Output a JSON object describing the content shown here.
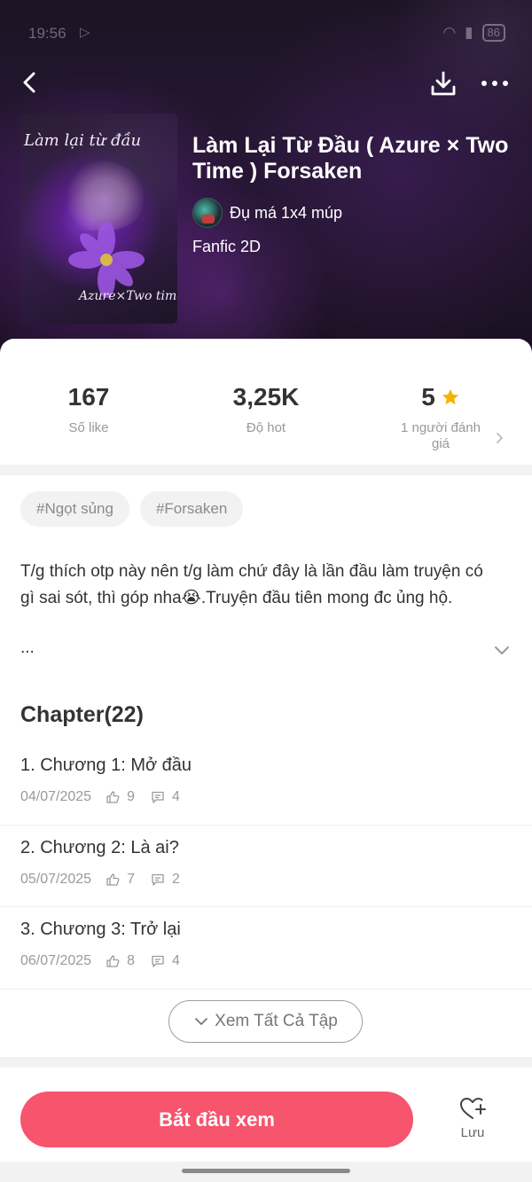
{
  "status_bar": {
    "time": "19:56",
    "battery": "86"
  },
  "header": {
    "cover_title_text": "Làm lại từ đầu",
    "cover_subtitle_text": "Azure×Two time",
    "title": "Làm Lại Từ Đầu ( Azure × Two Time ) Forsaken",
    "author": "Đụ má 1x4 múp",
    "genre": "Fanfic 2D"
  },
  "stats": {
    "likes": {
      "value": "167",
      "label": "Số like"
    },
    "hot": {
      "value": "3,25K",
      "label": "Độ hot"
    },
    "rating": {
      "value": "5",
      "label": "1 người đánh giá"
    }
  },
  "tags": [
    "#Ngọt sủng",
    "#Forsaken"
  ],
  "description": {
    "text": "T/g thích otp này nên t/g làm chứ đây là lần đầu làm truyện có gì sai sót, thì góp nha😭.Truyện đầu tiên mong đc ủng hộ.",
    "more": "..."
  },
  "chapters": {
    "heading": "Chapter(22)",
    "items": [
      {
        "title": "1. Chương 1: Mở đầu",
        "date": "04/07/2025",
        "likes": "9",
        "comments": "4"
      },
      {
        "title": "2. Chương 2: Là ai?",
        "date": "05/07/2025",
        "likes": "7",
        "comments": "2"
      },
      {
        "title": "3. Chương 3: Trở lại",
        "date": "06/07/2025",
        "likes": "8",
        "comments": "4"
      }
    ],
    "see_all_label": "Xem Tất Cả Tập"
  },
  "bottom_bar": {
    "start_label": "Bắt đầu xem",
    "save_label": "Lưu"
  },
  "colors": {
    "accent": "#f7546d",
    "star": "#f5b301"
  },
  "icons": [
    "back-arrow-icon",
    "download-icon",
    "more-icon",
    "play-store-icon",
    "star-icon",
    "chevron-right-icon",
    "chevron-down-icon",
    "thumb-up-icon",
    "comment-icon",
    "heart-plus-icon"
  ]
}
